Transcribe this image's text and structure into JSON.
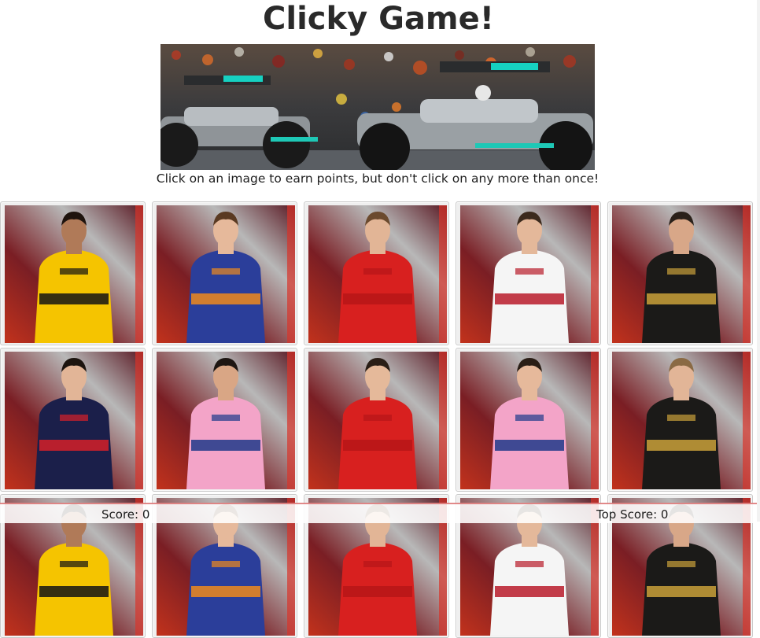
{
  "game": {
    "title": "Clicky Game!",
    "instructions": "Click on an image to earn points, but don't click on any more than once!"
  },
  "score": {
    "score_text": "Score: 0",
    "top_score_text": "Top Score: 0"
  },
  "cards": [
    {
      "suit": "#f5c400",
      "suit_dark": "#141414",
      "skin": "#b07a58",
      "hair": "#1f140e"
    },
    {
      "suit": "#2b3e9a",
      "suit_dark": "#f08a1c",
      "skin": "#e6b99b",
      "hair": "#5a3a22"
    },
    {
      "suit": "#d8201f",
      "suit_dark": "#b71618",
      "skin": "#e2b596",
      "hair": "#6b4a2e"
    },
    {
      "suit": "#f5f5f5",
      "suit_dark": "#b81b2a",
      "skin": "#e4b89a",
      "hair": "#3b2a1d"
    },
    {
      "suit": "#1b1a18",
      "suit_dark": "#c9a13a",
      "skin": "#d8a788",
      "hair": "#2a211a"
    },
    {
      "suit": "#1b1f4a",
      "suit_dark": "#d52028",
      "skin": "#e2b597",
      "hair": "#1c140f"
    },
    {
      "suit": "#f3a4c8",
      "suit_dark": "#1e3a8a",
      "skin": "#d9a685",
      "hair": "#1e1612"
    },
    {
      "suit": "#d8201f",
      "suit_dark": "#b71618",
      "skin": "#e5b99a",
      "hair": "#2a1e16"
    },
    {
      "suit": "#f3a4c8",
      "suit_dark": "#1e3a8a",
      "skin": "#e6b99b",
      "hair": "#2a1e16"
    },
    {
      "suit": "#1b1a18",
      "suit_dark": "#c9a13a",
      "skin": "#e2b597",
      "hair": "#8a6a44"
    }
  ]
}
